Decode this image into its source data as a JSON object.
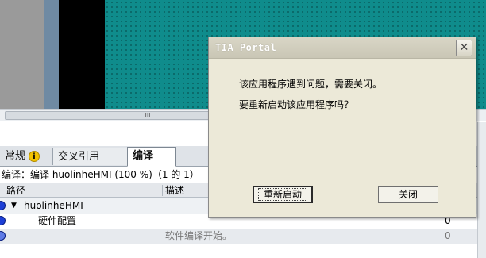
{
  "hscroll": {
    "grip": "III"
  },
  "inspector": {
    "tabs": [
      {
        "label": "常规",
        "icon": "info-icon",
        "icon_glyph": "i"
      },
      {
        "label": "交叉引用"
      },
      {
        "label": "编译"
      }
    ],
    "compile_status": "编译：编译 huolinheHMI (100 %)（1 的 1）",
    "columns": {
      "path": "路径",
      "desc": "描述"
    },
    "rows": [
      {
        "path": "huolinheHMI",
        "desc": "",
        "num": ""
      },
      {
        "path": "硬件配置",
        "desc": "",
        "num": "0"
      },
      {
        "path": "",
        "desc": "软件编译开始。",
        "num": "0"
      }
    ]
  },
  "dialog": {
    "title": "TIA Portal",
    "close_glyph": "✕",
    "line1": "该应用程序遇到问题，需要关闭。",
    "line2": "要重新启动该应用程序吗？",
    "buttons": {
      "restart": "重新启动",
      "close": "关闭"
    }
  }
}
